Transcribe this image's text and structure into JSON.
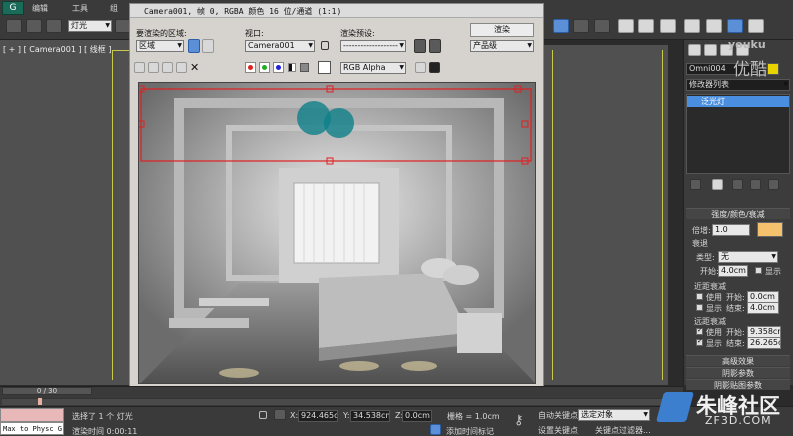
{
  "menubar": {
    "edit": "编辑",
    "tools": "工具",
    "group": "组"
  },
  "toolbar": {
    "selection_filter": "灯光"
  },
  "viewport_left": {
    "label": "[ + ] [ Camera001 ] [ 线框 ]"
  },
  "render_window": {
    "title": "Camera001, 帧 0, RGBA 颜色 16 位/通道 (1:1)",
    "area_label": "要渲染的区域:",
    "area_value": "区域",
    "viewport_label": "视口:",
    "viewport_value": "Camera001",
    "preset_label": "渲染预设:",
    "preset_value": "-------------------",
    "render_button": "渲染",
    "quality_value": "产品级",
    "channel_value": "RGB Alpha"
  },
  "right_panel": {
    "object_name": "Omni004",
    "modifier_list": "修改器列表",
    "stack_item": "泛光灯",
    "section_intensity": "强度/颜色/衰减",
    "multiplier_label": "倍增:",
    "multiplier_value": "1.0",
    "decay_label": "衰退",
    "type_label": "类型:",
    "type_value": "无",
    "start_label": "开始:",
    "start_value": "4.0cm",
    "show_label": "显示",
    "near_atten": "近距衰减",
    "use_label": "使用",
    "near_start_label": "开始:",
    "near_start_value": "0.0cm",
    "near_end_label": "结束:",
    "near_end_value": "4.0cm",
    "far_atten": "远距衰减",
    "far_start_label": "开始:",
    "far_start_value": "9.358cm",
    "far_end_label": "结束:",
    "far_end_value": "26.265c",
    "section_advanced": "高级效果",
    "section_shadow": "阴影参数",
    "section_shadowmap": "阴影贴图参数",
    "multiplier_color": "#f5c16c"
  },
  "timeline": {
    "frame": "0 / 30"
  },
  "statusbar": {
    "script_box": "Max to Physc G",
    "status_text": "选择了 1 个 灯光",
    "render_time": "渲染时间 0:00:11",
    "x_label": "X:",
    "x_value": "924.465cm",
    "y_label": "Y:",
    "y_value": "34.538cm",
    "z_label": "Z:",
    "z_value": "0.0cm",
    "grid_label": "栅格 = 1.0cm",
    "add_time_tag": "添加时间标记",
    "auto_key": "自动关键点",
    "set_key": "设置关键点",
    "selected_object": "选定对象",
    "key_filters": "关键点过滤器..."
  },
  "watermark": {
    "youku": "youku",
    "youku_cn": "优酷",
    "zf3d_cn": "朱峰社区",
    "zf3d_url": "ZF3D.COM"
  }
}
